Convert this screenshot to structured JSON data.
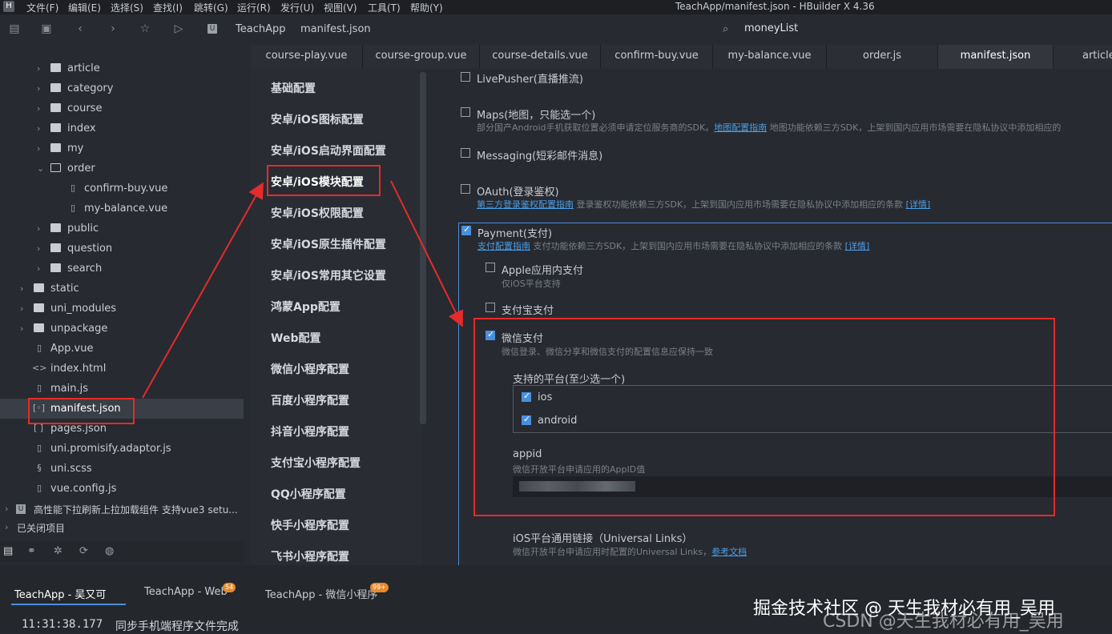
{
  "menubar": {
    "items": [
      "文件(F)",
      "编辑(E)",
      "选择(S)",
      "查找(I)",
      "跳转(G)",
      "运行(R)",
      "发行(U)",
      "视图(V)",
      "工具(T)",
      "帮助(Y)"
    ],
    "window_title": "TeachApp/manifest.json - HBuilder X 4.36"
  },
  "toolbar": {
    "breadcrumb": [
      "TeachApp",
      "manifest.json"
    ],
    "search_value": "moneyList"
  },
  "tree": {
    "items": [
      {
        "label": "article",
        "type": "folder"
      },
      {
        "label": "category",
        "type": "folder"
      },
      {
        "label": "course",
        "type": "folder"
      },
      {
        "label": "index",
        "type": "folder"
      },
      {
        "label": "my",
        "type": "folder"
      },
      {
        "label": "order",
        "type": "folder-open"
      },
      {
        "label": "confirm-buy.vue",
        "type": "vue"
      },
      {
        "label": "my-balance.vue",
        "type": "vue"
      },
      {
        "label": "public",
        "type": "folder"
      },
      {
        "label": "question",
        "type": "folder"
      },
      {
        "label": "search",
        "type": "folder"
      },
      {
        "label": "static",
        "type": "folder"
      },
      {
        "label": "uni_modules",
        "type": "folder"
      },
      {
        "label": "unpackage",
        "type": "folder"
      },
      {
        "label": "App.vue",
        "type": "vue"
      },
      {
        "label": "index.html",
        "type": "html"
      },
      {
        "label": "main.js",
        "type": "js"
      },
      {
        "label": "manifest.json",
        "type": "json-config"
      },
      {
        "label": "pages.json",
        "type": "json"
      },
      {
        "label": "uni.promisify.adaptor.js",
        "type": "js"
      },
      {
        "label": "uni.scss",
        "type": "scss"
      },
      {
        "label": "vue.config.js",
        "type": "js"
      },
      {
        "label": "高性能下拉刷新上拉加载组件 支持vue3 setu...",
        "type": "project"
      },
      {
        "label": "已关闭项目",
        "type": "group"
      }
    ]
  },
  "tabs": [
    "course-play.vue",
    "course-group.vue",
    "course-details.vue",
    "confirm-buy.vue",
    "my-balance.vue",
    "order.js",
    "manifest.json",
    "article"
  ],
  "manifest_nav": [
    "基础配置",
    "安卓/iOS图标配置",
    "安卓/iOS启动界面配置",
    "安卓/iOS模块配置",
    "安卓/iOS权限配置",
    "安卓/iOS原生插件配置",
    "安卓/iOS常用其它设置",
    "鸿蒙App配置",
    "Web配置",
    "微信小程序配置",
    "百度小程序配置",
    "抖音小程序配置",
    "支付宝小程序配置",
    "QQ小程序配置",
    "快手小程序配置",
    "飞书小程序配置"
  ],
  "content": {
    "livepusher": "LivePusher(直播推流)",
    "maps": "Maps(地图，只能选一个)",
    "maps_desc": "部分国产Android手机获取位置必须申请定位服务商的SDK。",
    "maps_link": "地图配置指南",
    "maps_desc2": "地图功能依赖三方SDK，上架到国内应用市场需要在隐私协议中添加相应的",
    "messaging": "Messaging(短彩邮件消息)",
    "oauth": "OAuth(登录鉴权)",
    "oauth_link": "第三方登录鉴权配置指南",
    "oauth_desc": "登录鉴权功能依赖三方SDK，上架到国内应用市场需要在隐私协议中添加相应的条款",
    "oauth_detail": "[详情]",
    "payment": "Payment(支付)",
    "payment_link": "支付配置指南",
    "payment_desc": "支付功能依赖三方SDK，上架到国内应用市场需要在隐私协议中添加相应的条款",
    "payment_detail": "[详情]",
    "apple_pay": "Apple应用内支付",
    "apple_pay_desc": "仅iOS平台支持",
    "alipay": "支付宝支付",
    "wechat_pay": "微信支付",
    "wechat_pay_desc": "微信登录、微信分享和微信支付的配置信息应保持一致",
    "platforms_label": "支持的平台(至少选一个)",
    "platform_ios": "ios",
    "platform_android": "android",
    "appid_label": "appid",
    "appid_desc": "微信开放平台申请应用的AppID值",
    "universal_label": "iOS平台通用链接（Universal Links）",
    "universal_desc": "微信开放平台申请应用时配置的Universal Links，",
    "universal_link": "参考文档"
  },
  "console": {
    "tabs": [
      "TeachApp - 吴又可",
      "TeachApp - Web",
      "TeachApp - 微信小程序"
    ],
    "badges": [
      "54",
      "99+"
    ],
    "time": "11:31:38.177",
    "message": "同步手机端程序文件完成"
  },
  "watermark": {
    "line1": "掘金技术社区 @ 天生我材必有用_吴用",
    "line2": "CSDN @天生我材必有用_吴用"
  }
}
